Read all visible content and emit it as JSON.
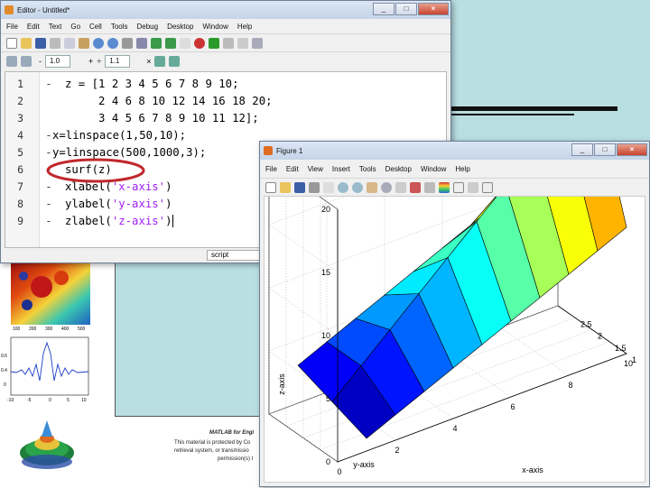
{
  "slide": {
    "footer_line1": "MATLAB for Engi",
    "footer_line2": "This material is protected by Co",
    "footer_line3": "retrieval system, or transmissio",
    "footer_line4": "permission(s) t"
  },
  "editor": {
    "title": "Editor - Untitled*",
    "menus": [
      "File",
      "Edit",
      "Text",
      "Go",
      "Cell",
      "Tools",
      "Debug",
      "Desktop",
      "Window",
      "Help"
    ],
    "toolbar2": {
      "decrement": "-",
      "value1": "1.0",
      "increment": "+",
      "divide": "÷",
      "value2": "1.1",
      "multiply": "×"
    },
    "lines": [
      {
        "num": "1",
        "text": "z = [1 2 3 4 5 6 7 8 9 10;"
      },
      {
        "num": "2",
        "text": "     2 4 6 8 10 12 14 16 18 20;"
      },
      {
        "num": "3",
        "text": "     3 4 5 6 7 8 9 10 11 12];"
      },
      {
        "num": "4",
        "text": "x=linspace(1,50,10);"
      },
      {
        "num": "5",
        "text": "y=linspace(500,1000,3);"
      },
      {
        "num": "6",
        "text": "surf(z)"
      },
      {
        "num": "7",
        "text_pre": "xlabel(",
        "text_str": "'x-axis'",
        "text_post": ")"
      },
      {
        "num": "8",
        "text_pre": "ylabel(",
        "text_str": "'y-axis'",
        "text_post": ")"
      },
      {
        "num": "9",
        "text_pre": "zlabel(",
        "text_str": "'z-axis'",
        "text_post": ")"
      }
    ],
    "status_mode": "script",
    "highlight_color": "#c0282d"
  },
  "figure": {
    "title": "Figure 1",
    "menus": [
      "File",
      "Edit",
      "View",
      "Insert",
      "Tools",
      "Desktop",
      "Window",
      "Help"
    ],
    "zlabel": "z-axis",
    "ylabel": "y-axis",
    "xlabel": "x-axis",
    "z_ticks": [
      "0",
      "5",
      "10",
      "15",
      "20"
    ],
    "y_ticks": [
      "1",
      "1.5",
      "2",
      "2.5"
    ],
    "x_ticks": [
      "0",
      "2",
      "4",
      "6",
      "8",
      "10"
    ]
  },
  "chart_data": {
    "type": "surface",
    "z": [
      [
        1,
        2,
        3,
        4,
        5,
        6,
        7,
        8,
        9,
        10
      ],
      [
        2,
        4,
        6,
        8,
        10,
        12,
        14,
        16,
        18,
        20
      ],
      [
        3,
        4,
        5,
        6,
        7,
        8,
        9,
        10,
        11,
        12
      ]
    ],
    "xlabel": "x-axis",
    "ylabel": "y-axis",
    "zlabel": "z-axis",
    "xlim": [
      0,
      10
    ],
    "ylim": [
      1,
      3
    ],
    "zlim": [
      0,
      20
    ],
    "colormap": "jet",
    "grid": true
  },
  "thumbnails": {
    "line_plot_y_ticks": [
      "0.6",
      "0.4",
      "0"
    ],
    "line_plot_x_ticks": [
      "-10",
      "-5",
      "0",
      "5",
      "10"
    ],
    "fractal_x_ticks": [
      "100",
      "200",
      "300",
      "400",
      "500"
    ]
  }
}
